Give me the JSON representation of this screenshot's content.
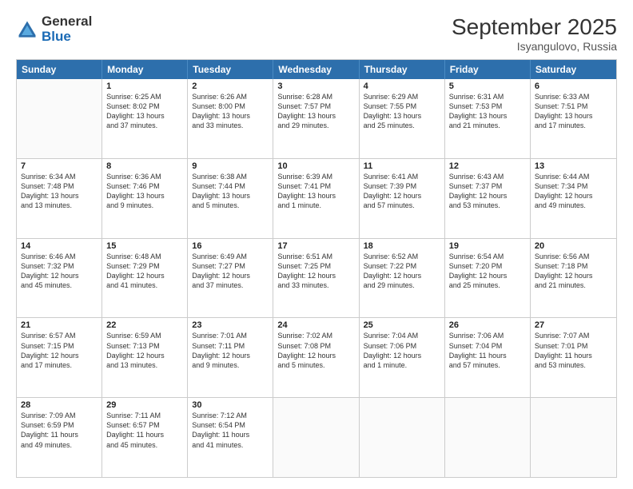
{
  "header": {
    "logo_line1": "General",
    "logo_line2": "Blue",
    "month": "September 2025",
    "location": "Isyangulovo, Russia"
  },
  "days_of_week": [
    "Sunday",
    "Monday",
    "Tuesday",
    "Wednesday",
    "Thursday",
    "Friday",
    "Saturday"
  ],
  "weeks": [
    [
      {
        "day": "",
        "info": ""
      },
      {
        "day": "1",
        "info": "Sunrise: 6:25 AM\nSunset: 8:02 PM\nDaylight: 13 hours\nand 37 minutes."
      },
      {
        "day": "2",
        "info": "Sunrise: 6:26 AM\nSunset: 8:00 PM\nDaylight: 13 hours\nand 33 minutes."
      },
      {
        "day": "3",
        "info": "Sunrise: 6:28 AM\nSunset: 7:57 PM\nDaylight: 13 hours\nand 29 minutes."
      },
      {
        "day": "4",
        "info": "Sunrise: 6:29 AM\nSunset: 7:55 PM\nDaylight: 13 hours\nand 25 minutes."
      },
      {
        "day": "5",
        "info": "Sunrise: 6:31 AM\nSunset: 7:53 PM\nDaylight: 13 hours\nand 21 minutes."
      },
      {
        "day": "6",
        "info": "Sunrise: 6:33 AM\nSunset: 7:51 PM\nDaylight: 13 hours\nand 17 minutes."
      }
    ],
    [
      {
        "day": "7",
        "info": "Sunrise: 6:34 AM\nSunset: 7:48 PM\nDaylight: 13 hours\nand 13 minutes."
      },
      {
        "day": "8",
        "info": "Sunrise: 6:36 AM\nSunset: 7:46 PM\nDaylight: 13 hours\nand 9 minutes."
      },
      {
        "day": "9",
        "info": "Sunrise: 6:38 AM\nSunset: 7:44 PM\nDaylight: 13 hours\nand 5 minutes."
      },
      {
        "day": "10",
        "info": "Sunrise: 6:39 AM\nSunset: 7:41 PM\nDaylight: 13 hours\nand 1 minute."
      },
      {
        "day": "11",
        "info": "Sunrise: 6:41 AM\nSunset: 7:39 PM\nDaylight: 12 hours\nand 57 minutes."
      },
      {
        "day": "12",
        "info": "Sunrise: 6:43 AM\nSunset: 7:37 PM\nDaylight: 12 hours\nand 53 minutes."
      },
      {
        "day": "13",
        "info": "Sunrise: 6:44 AM\nSunset: 7:34 PM\nDaylight: 12 hours\nand 49 minutes."
      }
    ],
    [
      {
        "day": "14",
        "info": "Sunrise: 6:46 AM\nSunset: 7:32 PM\nDaylight: 12 hours\nand 45 minutes."
      },
      {
        "day": "15",
        "info": "Sunrise: 6:48 AM\nSunset: 7:29 PM\nDaylight: 12 hours\nand 41 minutes."
      },
      {
        "day": "16",
        "info": "Sunrise: 6:49 AM\nSunset: 7:27 PM\nDaylight: 12 hours\nand 37 minutes."
      },
      {
        "day": "17",
        "info": "Sunrise: 6:51 AM\nSunset: 7:25 PM\nDaylight: 12 hours\nand 33 minutes."
      },
      {
        "day": "18",
        "info": "Sunrise: 6:52 AM\nSunset: 7:22 PM\nDaylight: 12 hours\nand 29 minutes."
      },
      {
        "day": "19",
        "info": "Sunrise: 6:54 AM\nSunset: 7:20 PM\nDaylight: 12 hours\nand 25 minutes."
      },
      {
        "day": "20",
        "info": "Sunrise: 6:56 AM\nSunset: 7:18 PM\nDaylight: 12 hours\nand 21 minutes."
      }
    ],
    [
      {
        "day": "21",
        "info": "Sunrise: 6:57 AM\nSunset: 7:15 PM\nDaylight: 12 hours\nand 17 minutes."
      },
      {
        "day": "22",
        "info": "Sunrise: 6:59 AM\nSunset: 7:13 PM\nDaylight: 12 hours\nand 13 minutes."
      },
      {
        "day": "23",
        "info": "Sunrise: 7:01 AM\nSunset: 7:11 PM\nDaylight: 12 hours\nand 9 minutes."
      },
      {
        "day": "24",
        "info": "Sunrise: 7:02 AM\nSunset: 7:08 PM\nDaylight: 12 hours\nand 5 minutes."
      },
      {
        "day": "25",
        "info": "Sunrise: 7:04 AM\nSunset: 7:06 PM\nDaylight: 12 hours\nand 1 minute."
      },
      {
        "day": "26",
        "info": "Sunrise: 7:06 AM\nSunset: 7:04 PM\nDaylight: 11 hours\nand 57 minutes."
      },
      {
        "day": "27",
        "info": "Sunrise: 7:07 AM\nSunset: 7:01 PM\nDaylight: 11 hours\nand 53 minutes."
      }
    ],
    [
      {
        "day": "28",
        "info": "Sunrise: 7:09 AM\nSunset: 6:59 PM\nDaylight: 11 hours\nand 49 minutes."
      },
      {
        "day": "29",
        "info": "Sunrise: 7:11 AM\nSunset: 6:57 PM\nDaylight: 11 hours\nand 45 minutes."
      },
      {
        "day": "30",
        "info": "Sunrise: 7:12 AM\nSunset: 6:54 PM\nDaylight: 11 hours\nand 41 minutes."
      },
      {
        "day": "",
        "info": ""
      },
      {
        "day": "",
        "info": ""
      },
      {
        "day": "",
        "info": ""
      },
      {
        "day": "",
        "info": ""
      }
    ]
  ]
}
